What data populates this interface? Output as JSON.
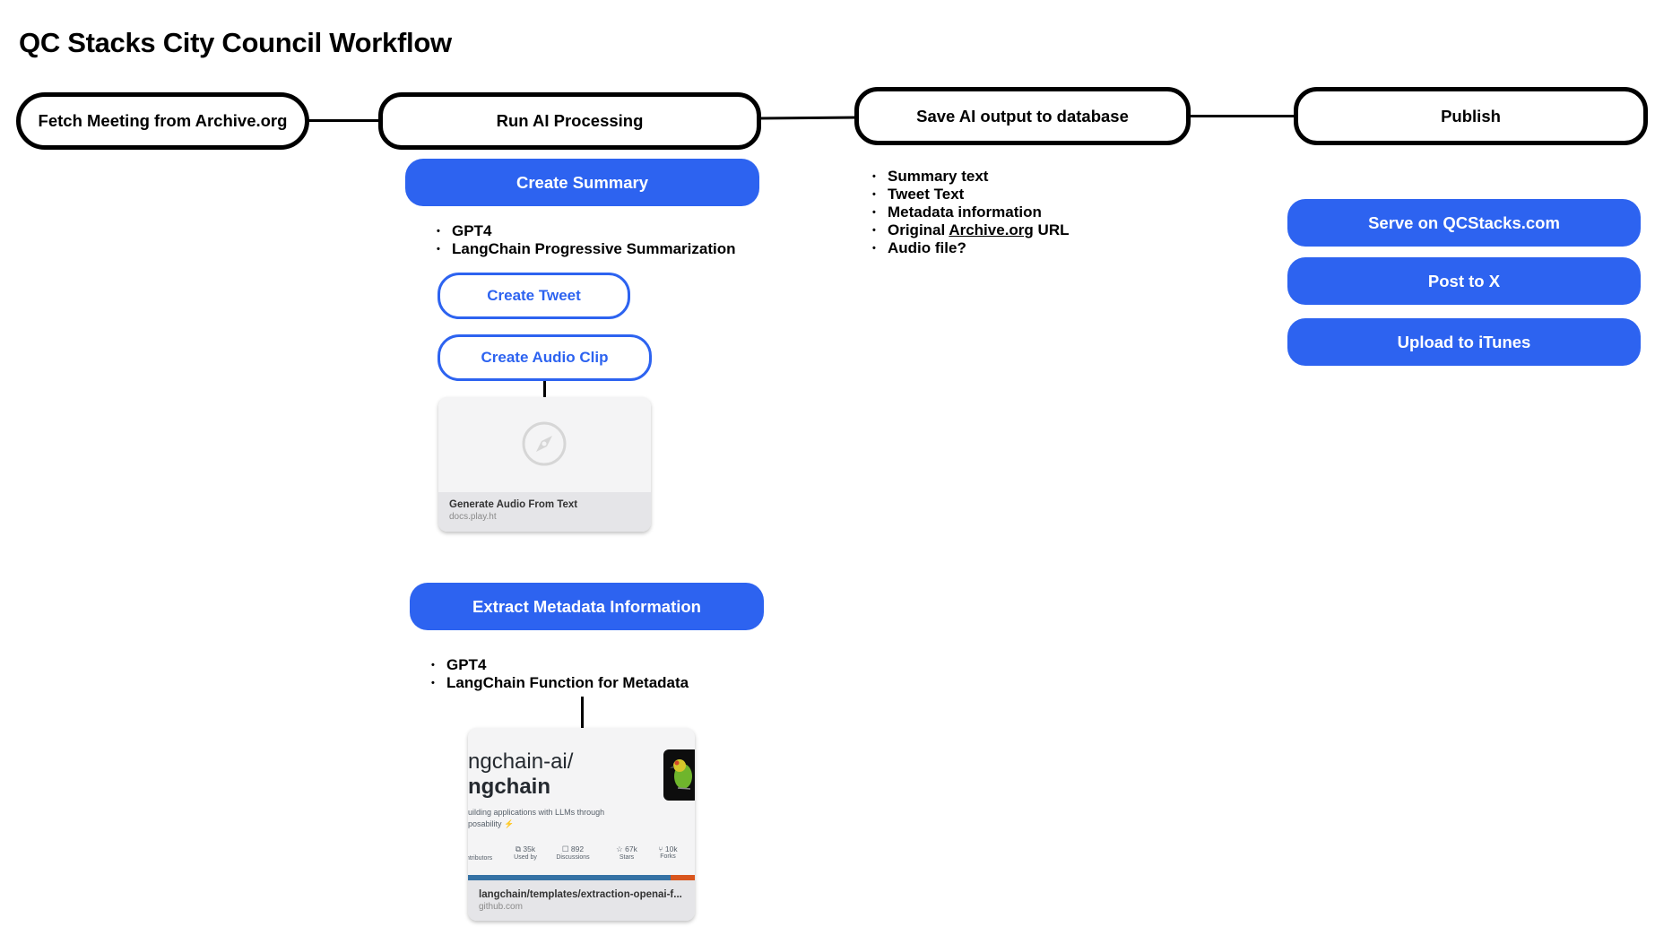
{
  "title": "QC Stacks City Council Workflow",
  "stages": [
    {
      "label": "Fetch Meeting from Archive.org"
    },
    {
      "label": "Run AI Processing"
    },
    {
      "label": "Save AI output to database"
    },
    {
      "label": "Publish"
    }
  ],
  "ai_processing": {
    "create_summary": {
      "label": "Create Summary",
      "bullets": [
        "GPT4",
        "LangChain Progressive Summarization"
      ]
    },
    "create_tweet": {
      "label": "Create Tweet"
    },
    "create_audio_clip": {
      "label": "Create Audio Clip",
      "link_card": {
        "icon": "compass-icon",
        "title": "Generate Audio From Text",
        "host": "docs.play.ht"
      }
    },
    "extract_metadata": {
      "label": "Extract Metadata Information",
      "bullets": [
        "GPT4",
        "LangChain Function for Metadata"
      ],
      "link_card": {
        "repo_owner": "ngchain-ai/",
        "repo_name": "ngchain",
        "description_line1": "uilding applications with LLMs through",
        "description_line2": "posability ⚡",
        "stats": [
          {
            "icon": "contributors-icon",
            "value": "",
            "label": "ntributors"
          },
          {
            "icon": "used-by-icon",
            "value": "35k",
            "label": "Used by"
          },
          {
            "icon": "discussions-icon",
            "value": "892",
            "label": "Discussions"
          },
          {
            "icon": "star-icon",
            "value": "67k",
            "label": "Stars"
          },
          {
            "icon": "fork-icon",
            "value": "10k",
            "label": "Forks"
          }
        ],
        "title": "langchain/templates/extraction-openai-f...",
        "host": "github.com"
      }
    }
  },
  "save_output": {
    "bullets": [
      {
        "text": "Summary text"
      },
      {
        "text": "Tweet Text"
      },
      {
        "text": "Metadata information"
      },
      {
        "prefix": "Original ",
        "link": "Archive.org",
        "suffix": " URL"
      },
      {
        "text": "Audio file?"
      }
    ]
  },
  "publish": {
    "buttons": [
      {
        "label": "Serve on QCStacks.com"
      },
      {
        "label": "Post to X"
      },
      {
        "label": "Upload to iTunes"
      }
    ]
  },
  "colors": {
    "accent": "#2d63f0",
    "stage_border": "#000000",
    "background": "#ffffff"
  }
}
